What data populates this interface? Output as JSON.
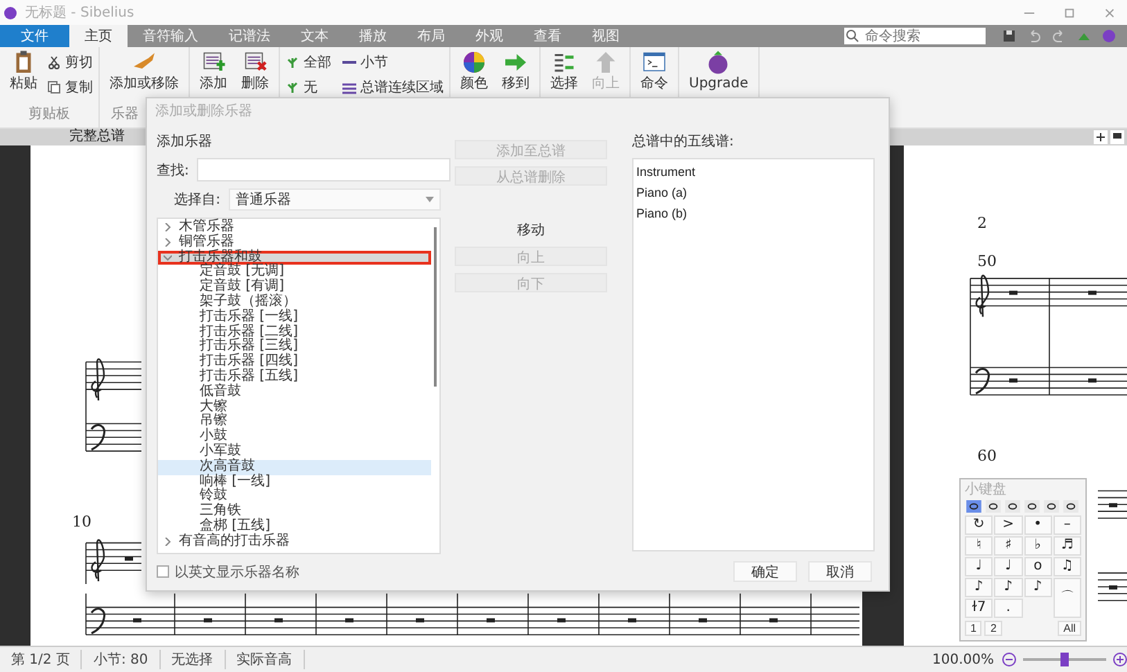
{
  "window": {
    "title": "无标题 - Sibelius"
  },
  "menu_tabs": [
    {
      "label": "文件",
      "kind": "file",
      "selected": false
    },
    {
      "label": "主页",
      "kind": "tab",
      "selected": true
    },
    {
      "label": "音符输入",
      "kind": "tab",
      "selected": false
    },
    {
      "label": "记谱法",
      "kind": "tab",
      "selected": false
    },
    {
      "label": "文本",
      "kind": "tab",
      "selected": false
    },
    {
      "label": "播放",
      "kind": "tab",
      "selected": false
    },
    {
      "label": "布局",
      "kind": "tab",
      "selected": false
    },
    {
      "label": "外观",
      "kind": "tab",
      "selected": false
    },
    {
      "label": "查看",
      "kind": "tab",
      "selected": false
    },
    {
      "label": "视图",
      "kind": "tab",
      "selected": false
    }
  ],
  "search": {
    "placeholder": "命令搜索"
  },
  "ribbon": {
    "groups": [
      {
        "label": "剪贴板",
        "items": [
          {
            "label": "粘贴",
            "kind": "large",
            "disabled": false
          },
          {
            "label": "剪切",
            "kind": "small",
            "disabled": false
          },
          {
            "label": "复制",
            "kind": "small",
            "disabled": false
          }
        ]
      },
      {
        "label": "乐器",
        "items": [
          {
            "label": "添加或移除",
            "kind": "large",
            "disabled": false
          }
        ]
      },
      {
        "items": [
          {
            "label": "添加",
            "kind": "large",
            "disabled": false
          },
          {
            "label": "删除",
            "kind": "large",
            "disabled": false
          }
        ]
      },
      {
        "items": [
          {
            "label": "全部",
            "kind": "small",
            "disabled": false
          },
          {
            "label": "小节",
            "kind": "small",
            "disabled": false
          },
          {
            "label": "无",
            "kind": "small",
            "disabled": false
          },
          {
            "label": "总谱连续区域",
            "kind": "small",
            "disabled": false
          }
        ]
      },
      {
        "items": [
          {
            "label": "颜色",
            "kind": "large",
            "disabled": false
          },
          {
            "label": "移到",
            "kind": "large",
            "disabled": false
          }
        ]
      },
      {
        "items": [
          {
            "label": "选择",
            "kind": "large",
            "disabled": false
          },
          {
            "label": "向上",
            "kind": "large",
            "disabled": true
          }
        ]
      },
      {
        "items": [
          {
            "label": "命令",
            "kind": "large",
            "disabled": false
          }
        ]
      },
      {
        "items": [
          {
            "label": "Upgrade",
            "kind": "large",
            "disabled": false
          }
        ]
      }
    ]
  },
  "score_tab": {
    "label": "完整总谱"
  },
  "score": {
    "measure_numbers": [
      "2",
      "50",
      "60",
      "10"
    ]
  },
  "dialog": {
    "title": "添加或删除乐器",
    "heading": "添加乐器",
    "find_label": "查找:",
    "choose_label": "选择自:",
    "choose_value": "普通乐器",
    "tree": [
      {
        "label": "木管乐器",
        "expanded": false,
        "selected": false,
        "outlined": false
      },
      {
        "label": "铜管乐器",
        "expanded": false,
        "selected": false,
        "outlined": false
      },
      {
        "label": "打击乐器和鼓",
        "expanded": true,
        "selected": true,
        "outlined": true,
        "children": [
          {
            "label": "定音鼓 [无调]",
            "selected": false
          },
          {
            "label": "定音鼓 [有调]",
            "selected": false
          },
          {
            "label": "架子鼓（摇滚）",
            "selected": false
          },
          {
            "label": "打击乐器 [一线]",
            "selected": false
          },
          {
            "label": "打击乐器 [二线]",
            "selected": false
          },
          {
            "label": "打击乐器 [三线]",
            "selected": false
          },
          {
            "label": "打击乐器 [四线]",
            "selected": false
          },
          {
            "label": "打击乐器 [五线]",
            "selected": false
          },
          {
            "label": "低音鼓",
            "selected": false
          },
          {
            "label": "大镲",
            "selected": false
          },
          {
            "label": "吊镲",
            "selected": false
          },
          {
            "label": "小鼓",
            "selected": false
          },
          {
            "label": "小军鼓",
            "selected": false
          },
          {
            "label": "次高音鼓",
            "selected": true
          },
          {
            "label": "响棒 [一线]",
            "selected": false
          },
          {
            "label": "铃鼓",
            "selected": false
          },
          {
            "label": "三角铁",
            "selected": false
          },
          {
            "label": "盒梆 [五线]",
            "selected": false
          }
        ]
      },
      {
        "label": "有音高的打击乐器",
        "expanded": false,
        "selected": false,
        "outlined": false
      }
    ],
    "add_button": {
      "label": "添加至总谱",
      "disabled": true
    },
    "remove_button": {
      "label": "从总谱删除",
      "disabled": true
    },
    "move_label": "移动",
    "up_button": {
      "label": "向上",
      "disabled": true
    },
    "down_button": {
      "label": "向下",
      "disabled": true
    },
    "staves_label": "总谱中的五线谱:",
    "staves": [
      {
        "label": "Instrument",
        "selected": false
      },
      {
        "label": "Piano (a)",
        "selected": false
      },
      {
        "label": "Piano (b)",
        "selected": false
      }
    ],
    "english_names": {
      "label": "以英文显示乐器名称",
      "checked": false
    },
    "ok": "确定",
    "cancel": "取消"
  },
  "keypad": {
    "title": "小键盘",
    "modes": [
      {
        "selected": true
      },
      {
        "selected": false
      },
      {
        "selected": false
      },
      {
        "selected": false
      },
      {
        "selected": false
      },
      {
        "selected": false
      }
    ],
    "keys": [
      "↻",
      ">",
      "•",
      "–",
      "♮",
      "♯",
      "♭",
      "♬",
      "♩",
      "♩",
      "o",
      "♫",
      "♪",
      "♪",
      "♪",
      "⌒",
      "ɫ7",
      "."
    ],
    "layouts": [
      {
        "label": "1",
        "selected": false
      },
      {
        "label": "2",
        "selected": false
      }
    ],
    "all": "All"
  },
  "status_bar": {
    "items": [
      "第 1/2 页",
      "小节: 80",
      "无选择",
      "实际音高"
    ],
    "zoom": {
      "reading": "100.00%",
      "level": 0.5
    }
  }
}
